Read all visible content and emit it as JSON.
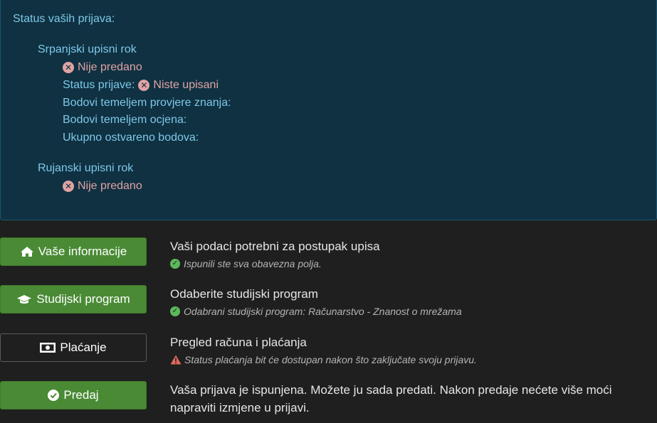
{
  "status": {
    "heading": "Status vaših prijava:",
    "terms": [
      {
        "name": "Srpanjski upisni rok",
        "state": "Nije predano",
        "status_label": "Status prijave:",
        "status_value": "Niste upisani",
        "points_exam_label": "Bodovi temeljem provjere znanja:",
        "points_grades_label": "Bodovi temeljem ocjena:",
        "points_total_label": "Ukupno ostvareno bodova:"
      },
      {
        "name": "Rujanski upisni rok",
        "state": "Nije predano"
      }
    ]
  },
  "steps": [
    {
      "button_label": "Vaše informacije",
      "icon": "home-icon",
      "title": "Vaši podaci potrebni za postupak upisa",
      "note": "Ispunili ste sva obavezna polja.",
      "note_type": "success"
    },
    {
      "button_label": "Studijski program",
      "icon": "graduation-cap-icon",
      "title": "Odaberite studijski program",
      "note": "Odabrani studijski program: Računarstvo - Znanost o mrežama",
      "note_type": "success"
    },
    {
      "button_label": "Plaćanje",
      "icon": "money-icon",
      "title": "Pregled računa i plaćanja",
      "note": "Status plaćanja bit će dostupan nakon što zaključate svoju prijavu.",
      "note_type": "warning"
    },
    {
      "button_label": "Predaj",
      "icon": "check-circle-icon",
      "title": "Vaša prijava je ispunjena. Možete ju sada predati. Nakon predaje nećete više moći napraviti izmjene u prijavi."
    }
  ],
  "colors": {
    "panel_bg": "#0f3142",
    "panel_text": "#7ec8e8",
    "error_text": "#e0a3a3",
    "button_green": "#4a8a35",
    "success_icon": "#5cb85c",
    "warning_icon": "#e06a5e"
  }
}
